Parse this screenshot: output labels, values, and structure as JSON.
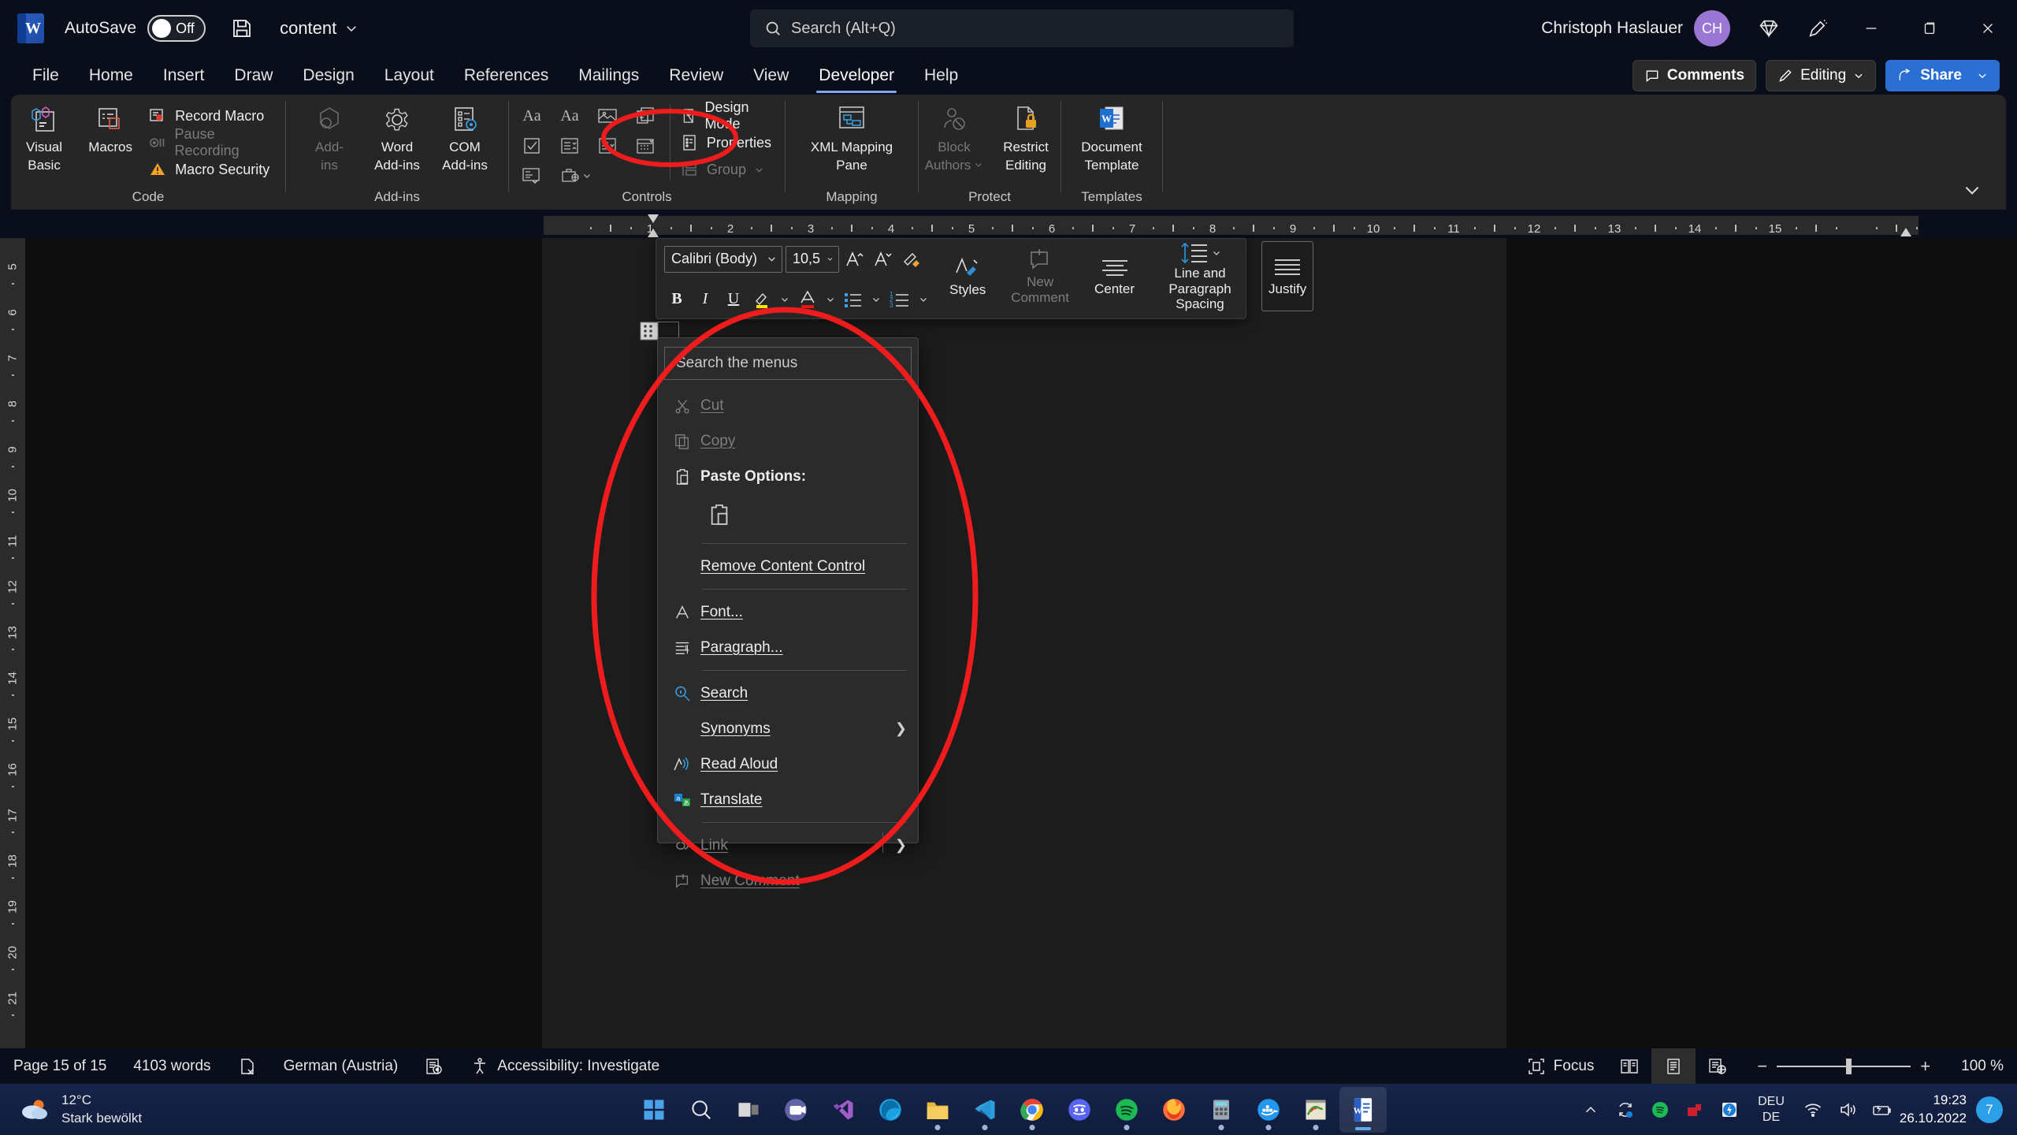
{
  "titlebar": {
    "app_icon": "word-logo-icon",
    "autosave_label": "AutoSave",
    "autosave_state": "Off",
    "save_icon": "save-icon",
    "document_name": "content",
    "document_chevron": "chevron-down-icon",
    "search_placeholder": "Search (Alt+Q)",
    "search_icon": "search-icon",
    "user_name": "Christoph Haslauer",
    "user_initials": "CH",
    "diamond_icon": "diamond-icon",
    "ribbon_display_icon": "pen-ribbon-icon",
    "minimize_icon": "minimize-icon",
    "restore_icon": "restore-icon",
    "close_icon": "close-icon"
  },
  "tabs": [
    {
      "label": "File",
      "active": false
    },
    {
      "label": "Home",
      "active": false
    },
    {
      "label": "Insert",
      "active": false
    },
    {
      "label": "Draw",
      "active": false
    },
    {
      "label": "Design",
      "active": false
    },
    {
      "label": "Layout",
      "active": false
    },
    {
      "label": "References",
      "active": false
    },
    {
      "label": "Mailings",
      "active": false
    },
    {
      "label": "Review",
      "active": false
    },
    {
      "label": "View",
      "active": false
    },
    {
      "label": "Developer",
      "active": true
    },
    {
      "label": "Help",
      "active": false
    }
  ],
  "ribbon_right": {
    "comments_label": "Comments",
    "comments_icon": "comment-icon",
    "editing_label": "Editing",
    "editing_icon": "pencil-icon",
    "editing_chevron": "chevron-down-icon",
    "share_label": "Share",
    "share_icon": "share-icon",
    "share_chevron": "chevron-down-icon",
    "collapse_icon": "chevron-down-icon"
  },
  "ribbon": {
    "groups": [
      {
        "name": "Code",
        "big_buttons": [
          {
            "label": "Visual\nBasic",
            "label_l1": "Visual",
            "label_l2": "Basic",
            "icon": "visual-basic-icon",
            "disabled": false
          },
          {
            "label": "Macros",
            "label_l1": "Macros",
            "label_l2": "",
            "icon": "macros-icon",
            "disabled": false
          }
        ],
        "small_buttons": [
          {
            "label": "Record Macro",
            "icon": "record-macro-icon",
            "disabled": false
          },
          {
            "label": "Pause Recording",
            "icon": "pause-recording-icon",
            "disabled": true
          },
          {
            "label": "Macro Security",
            "icon": "macro-security-icon",
            "disabled": false
          }
        ]
      },
      {
        "name": "Add-ins",
        "big_buttons": [
          {
            "label_l1": "Add-",
            "label_l2": "ins",
            "icon": "addins-icon",
            "disabled": true
          },
          {
            "label_l1": "Word",
            "label_l2": "Add-ins",
            "icon": "word-addins-icon",
            "disabled": false
          },
          {
            "label_l1": "COM",
            "label_l2": "Add-ins",
            "icon": "com-addins-icon",
            "disabled": false
          }
        ]
      },
      {
        "name": "Controls",
        "control_icons": [
          "rich-text-content-control-icon",
          "plain-text-content-control-icon",
          "picture-content-control-icon",
          "building-block-gallery-icon",
          "check-box-content-control-icon",
          "combo-box-content-control-icon",
          "drop-down-list-content-control-icon",
          "date-picker-content-control-icon",
          "repeating-section-content-control-icon",
          "legacy-tools-icon"
        ],
        "legacy_chevron": "chevron-down-icon",
        "right_buttons": [
          {
            "label": "Design Mode",
            "icon": "design-mode-icon",
            "disabled": false
          },
          {
            "label": "Properties",
            "icon": "properties-icon",
            "disabled": false,
            "highlighted": true
          },
          {
            "label": "Group",
            "icon": "group-icon",
            "disabled": true,
            "chevron": "chevron-down-icon"
          }
        ]
      },
      {
        "name": "Mapping",
        "big_buttons": [
          {
            "label_l1": "XML Mapping",
            "label_l2": "Pane",
            "icon": "xml-mapping-pane-icon",
            "disabled": false
          }
        ]
      },
      {
        "name": "Protect",
        "big_buttons": [
          {
            "label_l1": "Block",
            "label_l2": "Authors",
            "icon": "block-authors-icon",
            "disabled": true,
            "chevron": "chevron-down-icon"
          },
          {
            "label_l1": "Restrict",
            "label_l2": "Editing",
            "icon": "restrict-editing-icon",
            "disabled": false
          }
        ]
      },
      {
        "name": "Templates",
        "big_buttons": [
          {
            "label_l1": "Document",
            "label_l2": "Template",
            "icon": "document-template-icon",
            "disabled": false
          }
        ]
      }
    ]
  },
  "ruler": {
    "horizontal_numbers": [
      "1",
      "2",
      "3",
      "4",
      "5",
      "6",
      "7",
      "8",
      "9",
      "10",
      "11",
      "12",
      "13",
      "14",
      "15"
    ],
    "vertical_numbers": [
      "5",
      "6",
      "7",
      "8",
      "9",
      "10",
      "11",
      "12",
      "13",
      "14",
      "15",
      "16",
      "17",
      "18",
      "19",
      "20",
      "21"
    ]
  },
  "mini_toolbar": {
    "font_name": "Calibri (Body)",
    "font_name_chevron": "chevron-down-icon",
    "font_size": "10,5",
    "font_size_chevron": "chevron-down-icon",
    "grow_font_icon": "grow-font-icon",
    "shrink_font_icon": "shrink-font-icon",
    "format_painter_icon": "format-painter-icon",
    "bold_label": "B",
    "italic_label": "I",
    "underline_label": "U",
    "highlight_icon": "text-highlight-icon",
    "highlight_chevron": "chevron-down-icon",
    "font_color_icon": "font-color-icon",
    "font_color_chevron": "chevron-down-icon",
    "bullets_icon": "bullets-icon",
    "bullets_chevron": "chevron-down-icon",
    "numbering_icon": "numbering-icon",
    "numbering_chevron": "chevron-down-icon",
    "styles_label": "Styles",
    "styles_icon": "styles-icon",
    "styles_chevron": "chevron-down-icon",
    "new_comment_l1": "New",
    "new_comment_l2": "Comment",
    "new_comment_icon": "new-comment-icon",
    "center_label": "Center",
    "center_icon": "align-center-icon",
    "line_spacing_l1": "Line and",
    "line_spacing_l2": "Paragraph Spacing",
    "line_spacing_icon": "line-spacing-icon",
    "line_spacing_chevron": "chevron-down-icon",
    "justify_label": "Justify",
    "justify_icon": "align-justify-icon"
  },
  "context_menu": {
    "search_placeholder": "Search the menus",
    "items": [
      {
        "label": "Cut",
        "icon": "cut-icon",
        "disabled": true,
        "underline_index": 2
      },
      {
        "label": "Copy",
        "icon": "copy-icon",
        "disabled": true,
        "underline_index": 0
      },
      {
        "label": "Paste Options:",
        "icon": "paste-icon",
        "disabled": false,
        "bold": true
      },
      {
        "label": "",
        "icon": "keep-source-formatting-icon",
        "disabled": false,
        "is_paste_strip": true
      },
      {
        "label": "Remove Content Control",
        "icon": "",
        "disabled": false
      },
      {
        "label": "Font...",
        "icon": "font-icon",
        "disabled": false
      },
      {
        "label": "Paragraph...",
        "icon": "paragraph-icon",
        "disabled": false
      },
      {
        "label": "Search",
        "icon": "smart-lookup-icon",
        "disabled": false
      },
      {
        "label": "Synonyms",
        "icon": "",
        "disabled": false,
        "submenu": true
      },
      {
        "label": "Read Aloud",
        "icon": "read-aloud-icon",
        "disabled": false
      },
      {
        "label": "Translate",
        "icon": "translate-icon",
        "disabled": false
      },
      {
        "label": "Link",
        "icon": "link-icon",
        "disabled": true,
        "submenu": true
      },
      {
        "label": "New Comment",
        "icon": "new-comment-icon",
        "disabled": true
      }
    ]
  },
  "status_bar": {
    "page_info": "Page 15 of 15",
    "word_count": "4103 words",
    "proofing_icon": "proofing-errors-icon",
    "language": "German (Austria)",
    "track_changes_icon": "track-changes-icon",
    "accessibility": "Accessibility: Investigate",
    "accessibility_icon": "accessibility-icon",
    "focus_label": "Focus",
    "focus_icon": "focus-icon",
    "read_mode_icon": "read-mode-icon",
    "print_layout_icon": "print-layout-icon",
    "web_layout_icon": "web-layout-icon",
    "zoom_out_icon": "minus-icon",
    "zoom_in_icon": "plus-icon",
    "zoom_level": "100 %"
  },
  "taskbar": {
    "weather_temp": "12°C",
    "weather_desc": "Stark bewölkt",
    "weather_icon": "cloudy-icon",
    "apps": [
      {
        "name": "start-button",
        "icon": "windows-logo-icon",
        "running": false,
        "active": false
      },
      {
        "name": "search-button",
        "icon": "search-icon",
        "running": false,
        "active": false
      },
      {
        "name": "task-view-button",
        "icon": "task-view-icon",
        "running": false,
        "active": false
      },
      {
        "name": "teams-button",
        "icon": "teams-icon",
        "running": false,
        "active": false
      },
      {
        "name": "visual-studio-button",
        "icon": "visual-studio-icon",
        "running": false,
        "active": false
      },
      {
        "name": "edge-button",
        "icon": "edge-icon",
        "running": false,
        "active": false
      },
      {
        "name": "file-explorer-button",
        "icon": "folder-icon",
        "running": true,
        "active": false
      },
      {
        "name": "vscode-button",
        "icon": "vscode-icon",
        "running": true,
        "active": false
      },
      {
        "name": "chrome-button",
        "icon": "chrome-icon",
        "running": true,
        "active": false
      },
      {
        "name": "discord-button",
        "icon": "discord-icon",
        "running": false,
        "active": false
      },
      {
        "name": "spotify-button",
        "icon": "spotify-icon",
        "running": true,
        "active": false
      },
      {
        "name": "firefox-button",
        "icon": "firefox-icon",
        "running": false,
        "active": false
      },
      {
        "name": "calculator-button",
        "icon": "calculator-icon",
        "running": true,
        "active": false
      },
      {
        "name": "docker-button",
        "icon": "docker-icon",
        "running": true,
        "active": false
      },
      {
        "name": "paint-button",
        "icon": "paint-icon",
        "running": true,
        "active": false
      },
      {
        "name": "word-button",
        "icon": "word-icon",
        "running": true,
        "active": true
      }
    ],
    "tray": {
      "chevron_icon": "show-hidden-icons-icon",
      "onedrive_icon": "onedrive-sync-icon",
      "spotify_icon": "spotify-tray-icon",
      "tool_icon": "red-app-icon",
      "thunderbolt_icon": "thunderbolt-icon",
      "language_line1": "DEU",
      "language_line2": "DE",
      "wifi_icon": "wifi-icon",
      "volume_icon": "volume-icon",
      "battery_icon": "battery-charging-icon",
      "time": "19:23",
      "date": "26.10.2022",
      "notification_count": "7"
    }
  },
  "annotations": {
    "ellipse_properties": "red-ellipse-around-properties",
    "ellipse_context_menu": "red-ellipse-around-context-menu",
    "color": "#ee1c1c"
  }
}
